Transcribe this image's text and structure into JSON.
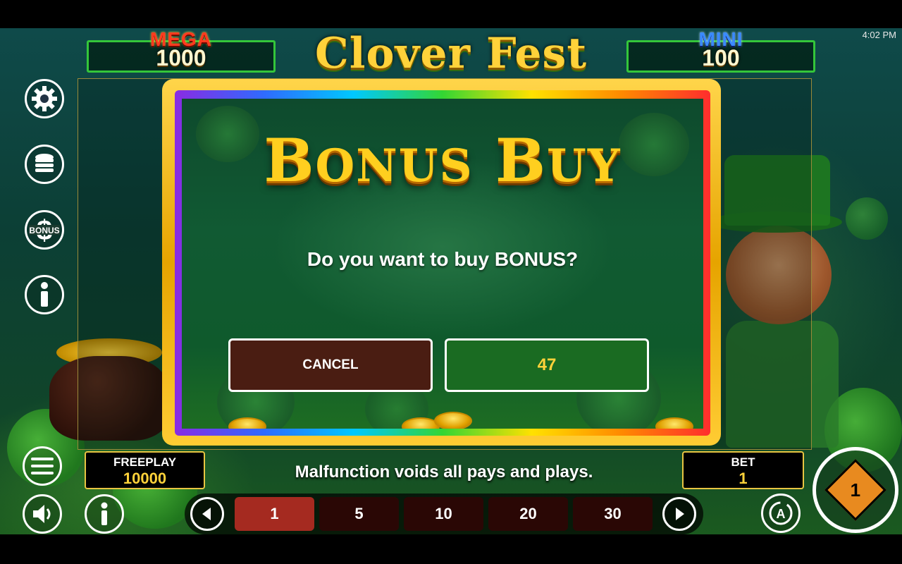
{
  "status_bar": {
    "time": "4:02 PM"
  },
  "game": {
    "logo_text": "Clover Fest"
  },
  "jackpots": {
    "mega": {
      "label": "MEGA",
      "value": "1000"
    },
    "mini": {
      "label": "MINI",
      "value": "100"
    }
  },
  "side_menu": {
    "bonus_icon_text": "BONUS"
  },
  "dialog": {
    "title_first": "B",
    "title_first_rest": "ONUS",
    "title_second": "B",
    "title_second_rest": "UY",
    "question": "Do you want to buy BONUS?",
    "cancel_label": "CANCEL",
    "price": "47"
  },
  "bottom": {
    "freeplay_label": "FREEPLAY",
    "freeplay_value": "10000",
    "disclaimer": "Malfunction voids all pays and plays.",
    "bet_label": "BET",
    "bet_value": "1",
    "bet_options": [
      "1",
      "5",
      "10",
      "20",
      "30"
    ],
    "selected_bet": "1",
    "auto_label": "A",
    "spin_badge": "1"
  },
  "colors": {
    "accent_gold": "#ffd23a",
    "frame_green": "#34c63a",
    "cancel_bg": "#4a1d12",
    "confirm_bg": "#1a6b22",
    "bet_active": "#a52a20"
  }
}
